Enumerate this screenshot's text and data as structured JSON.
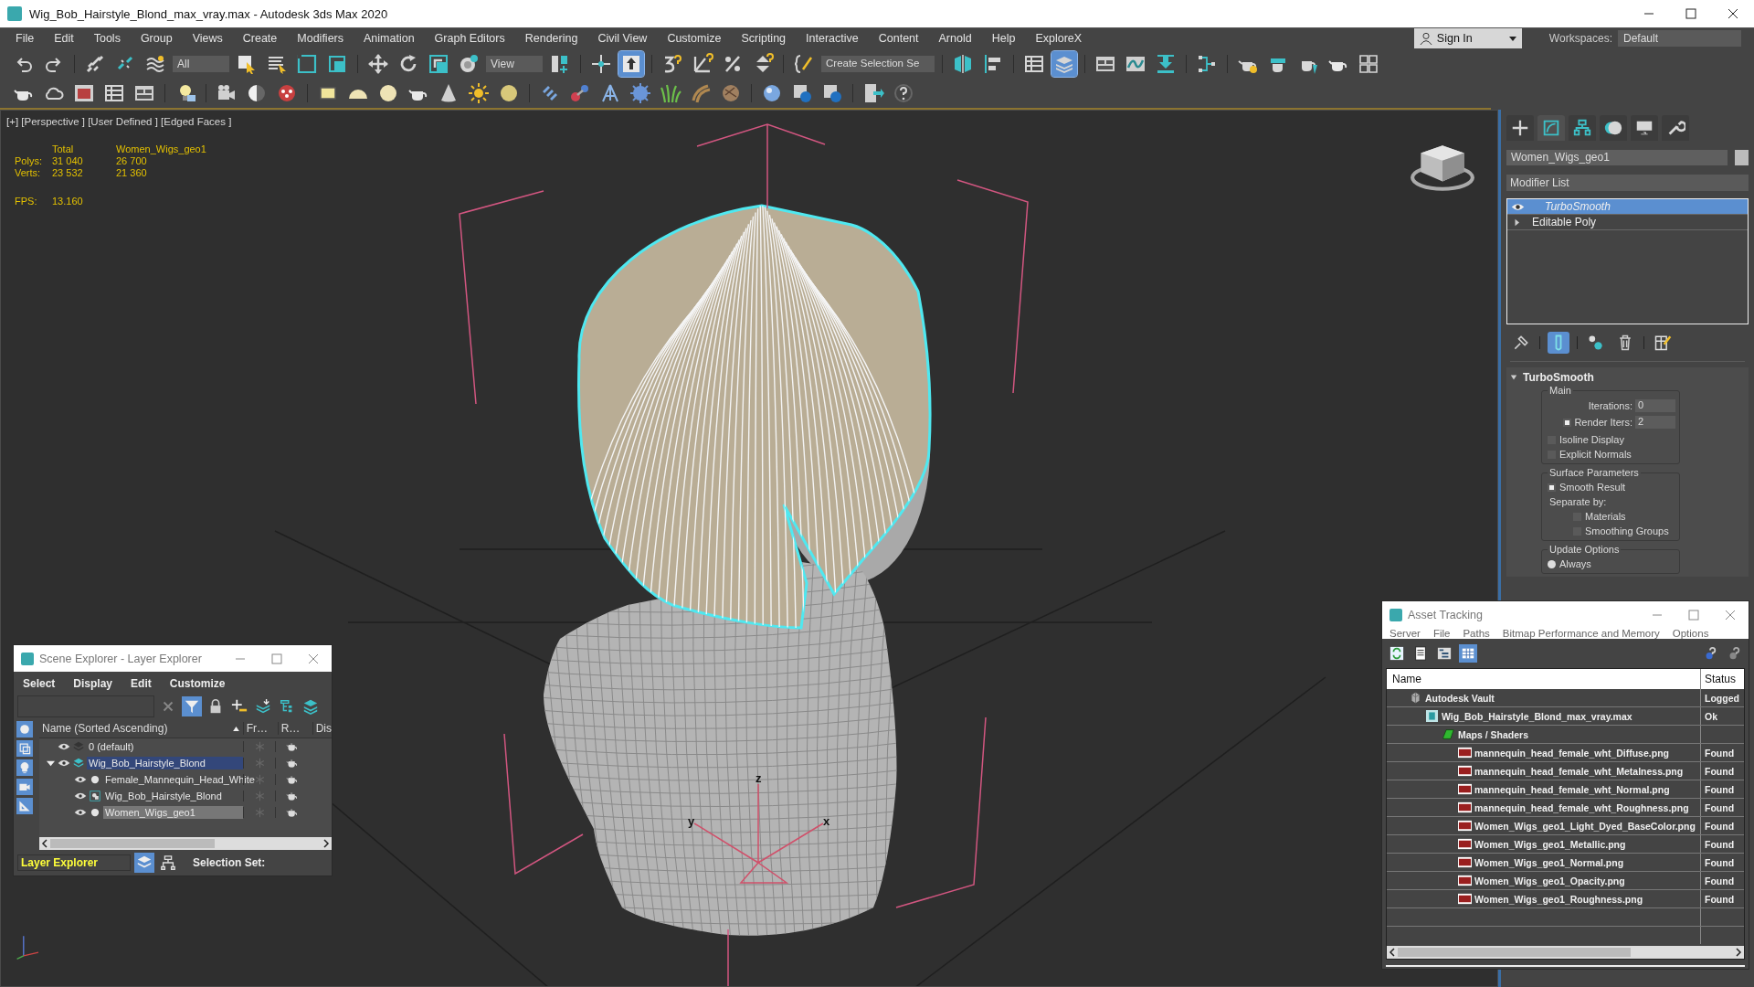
{
  "window": {
    "title": "Wig_Bob_Hairstyle_Blond_max_vray.max - Autodesk 3ds Max 2020"
  },
  "menu": [
    "File",
    "Edit",
    "Tools",
    "Group",
    "Views",
    "Create",
    "Modifiers",
    "Animation",
    "Graph Editors",
    "Rendering",
    "Civil View",
    "Customize",
    "Scripting",
    "Interactive",
    "Content",
    "Arnold",
    "Help",
    "ExploreX"
  ],
  "account": {
    "label": "Sign In"
  },
  "workspaces": {
    "label": "Workspaces:",
    "value": "Default"
  },
  "toolbar": {
    "selection_filter": "All",
    "reference_coordinate": "View",
    "named_selection": "Create Selection Se",
    "keyboard_override_on": true,
    "scene_explorer_on": true
  },
  "viewport": {
    "label": "[+] [Perspective ] [User Defined ] [Edged Faces ]",
    "stats": {
      "columns": [
        "Total",
        "Women_Wigs_geo1"
      ],
      "rows": [
        {
          "label": "Polys:",
          "values": [
            "31 040",
            "26 700"
          ]
        },
        {
          "label": "Verts:",
          "values": [
            "23 532",
            "21 360"
          ]
        }
      ],
      "fps_label": "FPS:",
      "fps": "13.160"
    },
    "gizmo_axes": [
      "z",
      "y",
      "x"
    ]
  },
  "command_panel": {
    "tabs": [
      {
        "selected": false
      },
      {
        "selected": true
      },
      {
        "selected": false
      },
      {
        "selected": false
      },
      {
        "selected": false
      },
      {
        "selected": false
      }
    ],
    "object_name": "Women_Wigs_geo1",
    "modifier_list": "Modifier List",
    "stack": [
      {
        "label": "TurboSmooth",
        "selected": true,
        "kind": "modifier"
      },
      {
        "label": "Editable Poly",
        "selected": false,
        "kind": "base"
      }
    ],
    "show_end_result_on": true,
    "rollout": {
      "title": "TurboSmooth",
      "main": {
        "title": "Main",
        "iterations": {
          "label": "Iterations:",
          "value": "0"
        },
        "render_iters": {
          "label": "Render Iters:",
          "value": "2",
          "checked": true
        },
        "isoline_display": {
          "label": "Isoline Display",
          "checked": false
        },
        "explicit_normals": {
          "label": "Explicit Normals",
          "checked": false
        }
      },
      "surface": {
        "title": "Surface Parameters",
        "smooth_result": {
          "label": "Smooth Result",
          "checked": true
        },
        "separate_by": "Separate by:",
        "materials": {
          "label": "Materials",
          "checked": false
        },
        "smoothing_groups": {
          "label": "Smoothing Groups",
          "checked": false
        }
      },
      "update": {
        "title": "Update Options",
        "always": {
          "label": "Always",
          "selected": true
        }
      }
    }
  },
  "scene_explorer": {
    "title": "Scene Explorer - Layer Explorer",
    "menu": [
      "Select",
      "Display",
      "Edit",
      "Customize"
    ],
    "filter_on": true,
    "columns": [
      "Name (Sorted Ascending)",
      "Fr…",
      "R…",
      "Dis"
    ],
    "tree": [
      {
        "label": "0 (default)",
        "kind": "layer",
        "current": false
      },
      {
        "label": "Wig_Bob_Hairstyle_Blond",
        "kind": "layer",
        "current": true,
        "expanded": true,
        "children": [
          {
            "label": "Female_Mannequin_Head_White",
            "kind": "object",
            "selected": false
          },
          {
            "label": "Wig_Bob_Hairstyle_Blond",
            "kind": "group",
            "selected": false
          },
          {
            "label": "Women_Wigs_geo1",
            "kind": "object",
            "selected": true
          }
        ]
      }
    ],
    "explorer_type": "Layer Explorer",
    "layer_view_on": true,
    "selection_set_label": "Selection Set:"
  },
  "asset_tracking": {
    "title": "Asset Tracking",
    "menu": [
      "Server",
      "File",
      "Paths",
      "Bitmap Performance and Memory",
      "Options"
    ],
    "table_view_on": true,
    "columns": [
      "Name",
      "Status"
    ],
    "tree": [
      {
        "name": "Autodesk Vault",
        "status": "Logged",
        "kind": "vault",
        "children": [
          {
            "name": "Wig_Bob_Hairstyle_Blond_max_vray.max",
            "status": "Ok",
            "kind": "scene",
            "children": [
              {
                "name": "Maps / Shaders",
                "kind": "folder",
                "children": [
                  {
                    "name": "mannequin_head_female_wht_Diffuse.png",
                    "status": "Found",
                    "kind": "image"
                  },
                  {
                    "name": "mannequin_head_female_wht_Metalness.png",
                    "status": "Found",
                    "kind": "image"
                  },
                  {
                    "name": "mannequin_head_female_wht_Normal.png",
                    "status": "Found",
                    "kind": "image"
                  },
                  {
                    "name": "mannequin_head_female_wht_Roughness.png",
                    "status": "Found",
                    "kind": "image"
                  },
                  {
                    "name": "Women_Wigs_geo1_Light_Dyed_BaseColor.png",
                    "status": "Found",
                    "kind": "image"
                  },
                  {
                    "name": "Women_Wigs_geo1_Metallic.png",
                    "status": "Found",
                    "kind": "image"
                  },
                  {
                    "name": "Women_Wigs_geo1_Normal.png",
                    "status": "Found",
                    "kind": "image"
                  },
                  {
                    "name": "Women_Wigs_geo1_Opacity.png",
                    "status": "Found",
                    "kind": "image"
                  },
                  {
                    "name": "Women_Wigs_geo1_Roughness.png",
                    "status": "Found",
                    "kind": "image"
                  }
                ]
              }
            ]
          }
        ]
      }
    ]
  }
}
